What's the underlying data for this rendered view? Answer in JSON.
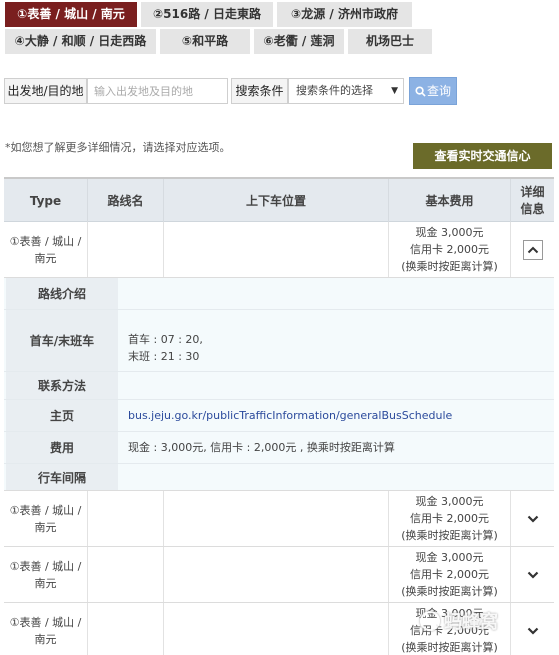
{
  "tabs": [
    {
      "label": "①表善 / 城山 / 南元"
    },
    {
      "label": "②516路 / 日走東路"
    },
    {
      "label": "③龙源 / 济州市政府"
    },
    {
      "label": "④大静 / 和顺 / 日走西路"
    },
    {
      "label": "⑤和平路"
    },
    {
      "label": "⑥老衢 / 莲洞"
    },
    {
      "label": "机场巴士"
    }
  ],
  "search": {
    "origin_label": "出发地/目的地",
    "origin_placeholder": "输入出发地及目的地",
    "condition_label": "搜索条件",
    "condition_value": "搜索条件的选择",
    "button_label": "查询"
  },
  "note": "*如您想了解更多详细情况，请选择对应选项。",
  "realtime_button": "查看实时交通信心",
  "table": {
    "headers": [
      "Type",
      "路线名",
      "上下车位置",
      "基本费用",
      "详细信息"
    ],
    "rows": [
      {
        "type": "①表善 / 城山 / 南元",
        "fee_cash": "现金 3,000元",
        "fee_card": "信用卡 2,000元",
        "fee_note": "(换乘时按距离计算)"
      },
      {
        "type": "①表善 / 城山 / 南元",
        "fee_cash": "现金 3,000元",
        "fee_card": "信用卡 2,000元",
        "fee_note": "(换乘时按距离计算)"
      },
      {
        "type": "①表善 / 城山 / 南元",
        "fee_cash": "现金 3,000元",
        "fee_card": "信用卡 2,000元",
        "fee_note": "(换乘时按距离计算)"
      },
      {
        "type": "①表善 / 城山 / 南元",
        "fee_cash": "现金 3,000元",
        "fee_card": "信用卡 2,000元",
        "fee_note": "(换乘时按距离计算)"
      }
    ]
  },
  "detail": {
    "intro_label": "路线介绍",
    "intro_value": "",
    "schedule_label": "首车/末班车",
    "first_bus": "首车 : 07 : 20,",
    "last_bus": "末班 : 21 : 30",
    "contact_label": "联系方法",
    "contact_value": "",
    "homepage_label": "主页",
    "homepage_value": "bus.jeju.go.kr/publicTrafficInformation/generalBusSchedule",
    "fee_label": "费用",
    "fee_value": "现金 : 3,000元, 信用卡 : 2,000元 , 换乘时按距离计算",
    "interval_label": "行车间隔",
    "interval_value": ""
  },
  "watermark": "蚂蜂窝",
  "colors": {
    "active_tab": "#7a1f1f",
    "search_button": "#8cb2e4",
    "realtime_button": "#6b6b2a",
    "link": "#2b4a9c"
  }
}
